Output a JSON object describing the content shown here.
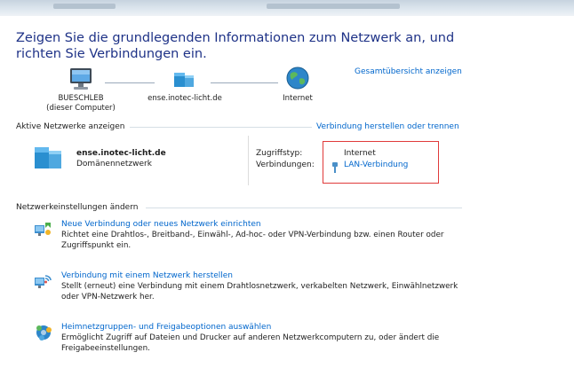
{
  "heading": "Zeigen Sie die grundlegenden Informationen zum Netzwerk an, und richten Sie Verbindungen ein.",
  "overview_link": "Gesamtübersicht anzeigen",
  "network_map": {
    "computer_name": "BUESCHLEB",
    "computer_sub": "(dieser Computer)",
    "domain_node": "ense.inotec-licht.de",
    "internet_node": "Internet"
  },
  "active_networks": {
    "section_label": "Aktive Netzwerke anzeigen",
    "connect_link": "Verbindung herstellen oder trennen",
    "network_name": "ense.inotec-licht.de",
    "network_type": "Domänennetzwerk",
    "access_type_label": "Zugriffstyp:",
    "access_type_value": "Internet",
    "connections_label": "Verbindungen:",
    "connections_value": "LAN-Verbindung"
  },
  "settings": {
    "section_label": "Netzwerkeinstellungen ändern",
    "tasks": [
      {
        "title": "Neue Verbindung oder neues Netzwerk einrichten",
        "desc": "Richtet eine Drahtlos-, Breitband-, Einwähl-, Ad-hoc- oder VPN-Verbindung bzw. einen Router oder Zugriffspunkt ein.",
        "icon": "new-connection-icon"
      },
      {
        "title": "Verbindung mit einem Netzwerk herstellen",
        "desc": "Stellt (erneut) eine Verbindung mit einem Drahtlosnetzwerk, verkabelten Netzwerk, Einwählnetzwerk oder VPN-Netzwerk her.",
        "icon": "connect-network-icon"
      },
      {
        "title": "Heimnetzgruppen- und Freigabeoptionen auswählen",
        "desc": "Ermöglicht Zugriff auf Dateien und Drucker auf anderen Netzwerkcomputern zu, oder ändert die Freigabeeinstellungen.",
        "icon": "homegroup-icon"
      }
    ]
  },
  "colors": {
    "heading": "#1e3287",
    "link": "#0066cc",
    "highlight_box": "#e03a3a"
  }
}
